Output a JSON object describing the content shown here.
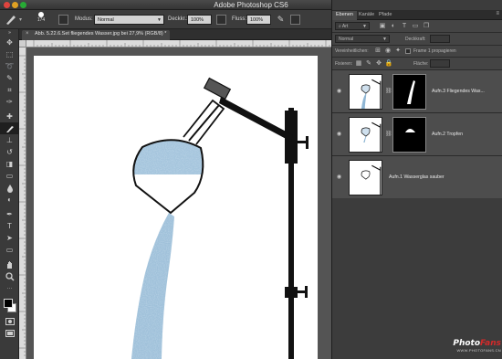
{
  "window": {
    "title": "Adobe Photoshop CS6"
  },
  "options_bar": {
    "brush_size": "174",
    "mode_label": "Modus:",
    "mode_value": "Normal",
    "opacity_label": "Deckkr.:",
    "opacity_value": "100%",
    "flow_label": "Fluss:",
    "flow_value": "100%"
  },
  "document": {
    "tab_title": "Abb. 5.22.6.Set fliegendes Wasser.jpg bei 27,9% (RGB/8) *"
  },
  "tools": [
    {
      "name": "move-tool",
      "glyph": "✥"
    },
    {
      "name": "marquee-tool",
      "glyph": "⬚"
    },
    {
      "name": "lasso-tool",
      "glyph": "➰"
    },
    {
      "name": "quick-select-tool",
      "glyph": "✎"
    },
    {
      "name": "crop-tool",
      "glyph": "⌗"
    },
    {
      "name": "eyedropper-tool",
      "glyph": "✑"
    },
    {
      "name": "healing-tool",
      "glyph": "✚"
    },
    {
      "name": "brush-tool",
      "glyph": "🖌"
    },
    {
      "name": "stamp-tool",
      "glyph": "⊥"
    },
    {
      "name": "history-brush-tool",
      "glyph": "↺"
    },
    {
      "name": "eraser-tool",
      "glyph": "◨"
    },
    {
      "name": "gradient-tool",
      "glyph": "▭"
    },
    {
      "name": "blur-tool",
      "glyph": "💧"
    },
    {
      "name": "dodge-tool",
      "glyph": "◐"
    },
    {
      "name": "pen-tool",
      "glyph": "✒"
    },
    {
      "name": "type-tool",
      "glyph": "T"
    },
    {
      "name": "path-select-tool",
      "glyph": "➤"
    },
    {
      "name": "shape-tool",
      "glyph": "▭"
    },
    {
      "name": "hand-tool",
      "glyph": "✋"
    },
    {
      "name": "zoom-tool",
      "glyph": "🔍"
    }
  ],
  "panel": {
    "tabs": [
      "Ebenen",
      "Kanäle",
      "Pfade"
    ],
    "filter_kind": "Art",
    "blend_mode": "Normal",
    "opacity_label": "Deckkraft:",
    "unify_label": "Vereinheitlichen:",
    "propagate_label": "Frame 1 propagieren",
    "lock_label": "Fixieren:",
    "fill_label": "Fläche:",
    "layers": [
      {
        "name": "Aufn.3 Fliegendes Was...",
        "has_mask": true,
        "mask_kind": "stream"
      },
      {
        "name": "Aufn.2 Tropfen",
        "has_mask": true,
        "mask_kind": "drop"
      },
      {
        "name": "Aufn.1 Wasserglas sauber",
        "has_mask": false,
        "mask_kind": ""
      }
    ]
  },
  "watermark": {
    "logo_a": "Photo",
    "logo_b": "Fans",
    "url": "WWW.PHOTOFANS.CN"
  },
  "colors": {
    "water": "#8fb6d4",
    "ui_dark": "#3c3c3c",
    "canvas": "#ffffff"
  }
}
